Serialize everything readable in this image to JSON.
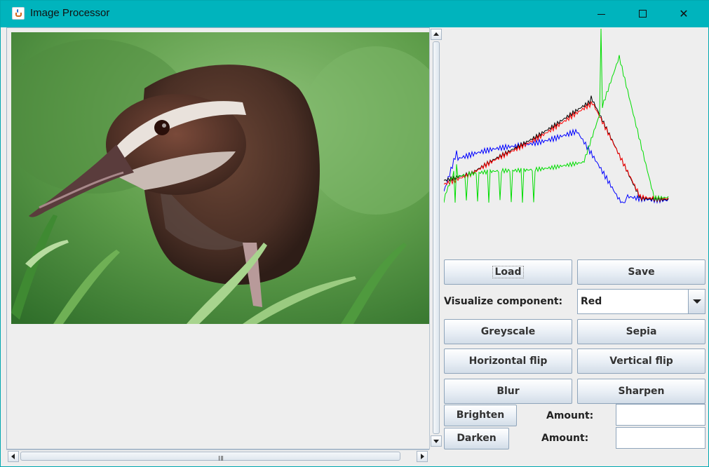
{
  "window": {
    "title": "Image Processor",
    "icon": "java-cup-icon",
    "minimize_icon": "minimize-icon",
    "maximize_icon": "maximize-icon",
    "close_icon": "close-icon",
    "close_glyph": "✕"
  },
  "image_panel": {
    "subject": "photo of a brown bird with a white eye stripe standing in green grass"
  },
  "histogram": {
    "series_colors": {
      "red": "#ff0000",
      "green": "#00dd00",
      "blue": "#0000ff",
      "luminance": "#000000"
    }
  },
  "controls": {
    "load_label": "Load",
    "save_label": "Save",
    "visualize_label": "Visualize component:",
    "component_selected": "Red",
    "greyscale_label": "Greyscale",
    "sepia_label": "Sepia",
    "hflip_label": "Horizontal flip",
    "vflip_label": "Vertical flip",
    "blur_label": "Blur",
    "sharpen_label": "Sharpen",
    "brighten_label": "Brighten",
    "darken_label": "Darken",
    "amount_label": "Amount:",
    "brighten_amount": "",
    "darken_amount": ""
  }
}
